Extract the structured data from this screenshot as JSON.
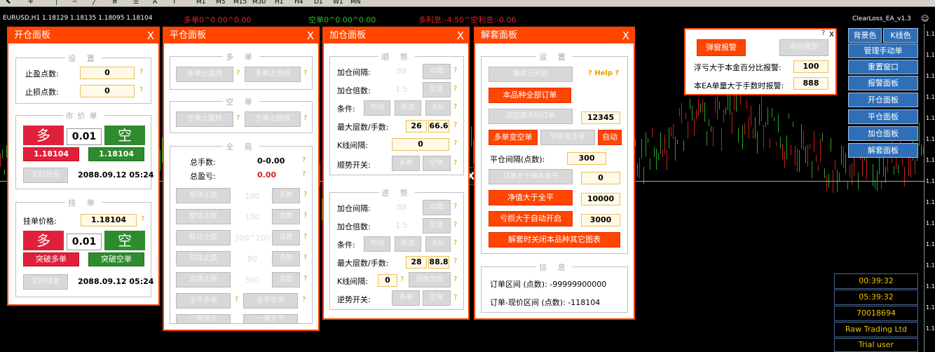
{
  "toolbar": {
    "timeframes": [
      "M1",
      "M5",
      "M15",
      "M30",
      "H1",
      "H4",
      "D1",
      "W1",
      "MN"
    ],
    "text_tool": "A"
  },
  "status": {
    "symbol_line": "EURUSD,H1  1.18129 1.18135 1.18095 1.18104",
    "long_info": "多单0^0.00^0.00",
    "short_info": "空单0^0.00^0.00",
    "swap_info": "多利息:-4.50^空利息:-0.06",
    "ea_name": "ClearLoss_EA_v1.3",
    "ea_icon": "smiley-icon"
  },
  "colors": {
    "accent": "#ff4500",
    "green": "#2e8b2e",
    "red": "#e0203a",
    "side_button": "#2f6fb8"
  },
  "open_panel": {
    "title": "开仓面板",
    "close": "X",
    "settings_label": "设 置",
    "tp_label": "止盈点数:",
    "tp_value": "0",
    "sl_label": "止损点数:",
    "sl_value": "0",
    "market_label": "市价单",
    "buy": "多",
    "lot": "0.01",
    "sell": "空",
    "buy_price": "1.18104",
    "sell_price": "1.18104",
    "timed_open": "定时开仓",
    "time": "2088.09.12 05:24",
    "pending_label": "挂 单",
    "pending_price_label": "挂单价格:",
    "pending_price": "1.18104",
    "buy2": "多",
    "lot2": "0.01",
    "sell2": "空",
    "breakout_buy": "突破多单",
    "breakout_sell": "突破空单",
    "timed_pending": "定时挂单",
    "time2": "2088.09.12 05:24"
  },
  "close_panel": {
    "title": "平仓面板",
    "close": "X",
    "long_label": "多 单",
    "long_tp": "多单止盈线",
    "long_sl": "多单止损线",
    "short_label": "空 单",
    "short_tp": "空单止盈线",
    "short_sl": "空单止损线",
    "all_label": "全 局",
    "total_lots_label": "总手数:",
    "total_lots": "0-0.00",
    "total_pnl_label": "总盈亏:",
    "total_pnl": "0.00",
    "rows": [
      {
        "btn": "整体止盈",
        "val": "100",
        "unit": "点数"
      },
      {
        "btn": "整体止损",
        "val": "100",
        "unit": "点数"
      },
      {
        "btn": "移动止盈",
        "val": "300^100",
        "unit": "点数"
      },
      {
        "btn": "总体止盈",
        "val": "80",
        "unit": "点数"
      },
      {
        "btn": "总体止损",
        "val": "500",
        "unit": "点数"
      }
    ],
    "close_all_long": "全平多单",
    "close_all_short": "全平空单",
    "one_click_lock": "一键锁仓",
    "one_click_close": "一键全平"
  },
  "add_panel": {
    "title": "加仓面板",
    "close": "X",
    "trend_label": "顺 势",
    "interval_label": "加仓间隔:",
    "interval": "88",
    "points": "点数",
    "multiple_label": "加仓倍数:",
    "multiple": "1.5",
    "double": "倍量",
    "condition_label": "条件:",
    "cond1": "均线",
    "cond2": "形态",
    "cond3": "RSI",
    "max_label": "最大层数/手数:",
    "max_layers": "26",
    "max_lots": "66.6",
    "kline_label": "K线间隔:",
    "kline": "0",
    "switch_label": "顺势开关:",
    "sw_long": "多单",
    "sw_short": "空单",
    "counter_label": "逆 势",
    "c_interval": "88",
    "c_multiple": "1.5",
    "c_max_layers": "28",
    "c_max_lots": "88.8",
    "c_kline": "0",
    "c_adjust": "逆施加仓",
    "c_switch_label": "逆势开关:"
  },
  "unlock_panel": {
    "title": "解套面板",
    "close": "X",
    "settings_label": "设 置",
    "unlock_open": "解套已开启",
    "help": "? Help ?",
    "all_orders": "本品种全部订单",
    "specified_orders": "指定魔术码订单",
    "magic": "12345",
    "long_to_short": "多单变空单",
    "short_to_long": "空单变多单",
    "auto": "自动",
    "close_interval_label": "平仓间隔(点数):",
    "close_interval": "300",
    "order_gt_principal": "订单大于单本金平",
    "order_val": "0",
    "equity_gt": "净值大于全平",
    "equity_val": "10000",
    "loss_gt": "亏损大于自动开启",
    "loss_val": "3000",
    "close_other_charts": "解套时关闭本品种其它图表",
    "info_label": "信 息",
    "range_label": "订单区间 (点数): -99999900000",
    "current_range_label": "订单-现价区间 (点数): -118104"
  },
  "alert_panel": {
    "popup_alert": "弹窗报警",
    "mail_alert": "邮件报警",
    "float_loss_label": "浮亏大于本金百分比报警:",
    "float_loss": "100",
    "single_lot_label": "本EA单量大于手数时报警:",
    "single_lot": "888",
    "help": "?",
    "close": "x"
  },
  "side_buttons": {
    "bg_color": "背景色",
    "kline_color": "K线色",
    "items": [
      "管理手动单",
      "重置窗口",
      "报警面板",
      "开仓面板",
      "平仓面板",
      "加仓面板",
      "解套面板"
    ]
  },
  "info_box": {
    "items": [
      "00:39:32",
      "05:39:32",
      "70018694",
      "Raw Trading Ltd",
      "Trial user"
    ]
  },
  "price_axis": {
    "labels": [
      "1.1",
      "1.1",
      "1.1",
      "1.1",
      "1.1",
      "1.1",
      "1.1",
      "1.1",
      "1.1",
      "1.1",
      "1.1",
      "1.1",
      "1.1",
      "1.1",
      "1.1"
    ],
    "current": "1.1"
  },
  "fx_logo": "FX"
}
